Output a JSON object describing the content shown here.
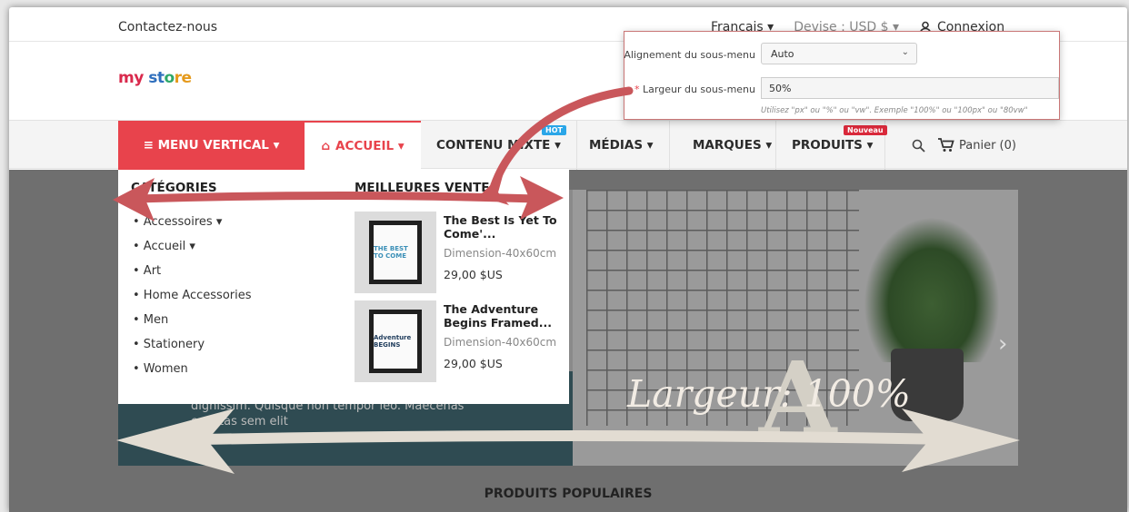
{
  "topbar": {
    "contact": "Contactez-nous",
    "language": "Français ▾",
    "currency": "Devise : USD $ ▾",
    "login": "Connexion"
  },
  "logo": {
    "part1": "my",
    "part2": " st",
    "part3": "o",
    "part4": "re"
  },
  "nav": {
    "vertical": "≡ MENU VERTICAL ▾",
    "home": "ACCUEIL ▾",
    "mixed": "CONTENU MIXTE ▾",
    "media": "MÉDIAS ▾",
    "brands": "MARQUES ▾",
    "products": "PRODUITS ▾",
    "cart": "Panier (0)",
    "badge_hot": "HOT",
    "badge_new": "Nouveau"
  },
  "dropdown": {
    "categories_title": "CATÉGORIES",
    "categories": [
      "• Accessoires ▾",
      "• Accueil ▾",
      "• Art",
      "• Home Accessories",
      "• Men",
      "• Stationery",
      "• Women"
    ],
    "bestsellers_title": "MEILLEURES VENTES",
    "products": [
      {
        "name": "The Best Is Yet To Come'...",
        "dimension": "Dimension-40x60cm",
        "price": "29,00 $US",
        "art": "THE BEST TO COME"
      },
      {
        "name": "The Adventure Begins Framed...",
        "dimension": "Dimension-40x60cm",
        "price": "29,00 $US",
        "art": "Adventure BEGINS"
      }
    ]
  },
  "slider": {
    "text": "dignissim. Quisque non tempor leo. Maecenas egestas sem elit"
  },
  "section": {
    "popular": "PRODUITS POPULAIRES"
  },
  "popup": {
    "align_label": "Alignement du sous-menu",
    "align_value": "Auto",
    "width_label": "Largeur du sous-menu",
    "width_required": "*",
    "width_value": "50%",
    "help": "Utilisez \"px\" ou \"%\" ou \"vw\". Exemple \"100%\" ou \"100px\" ou \"80vw\""
  },
  "annotation": {
    "largeur": "Largeur: 100%"
  },
  "colors": {
    "accent": "#e8434c",
    "arrow_red": "#c9575b",
    "arrow_beige": "#e2dcd2",
    "badge_hot": "#2aa6e8"
  }
}
